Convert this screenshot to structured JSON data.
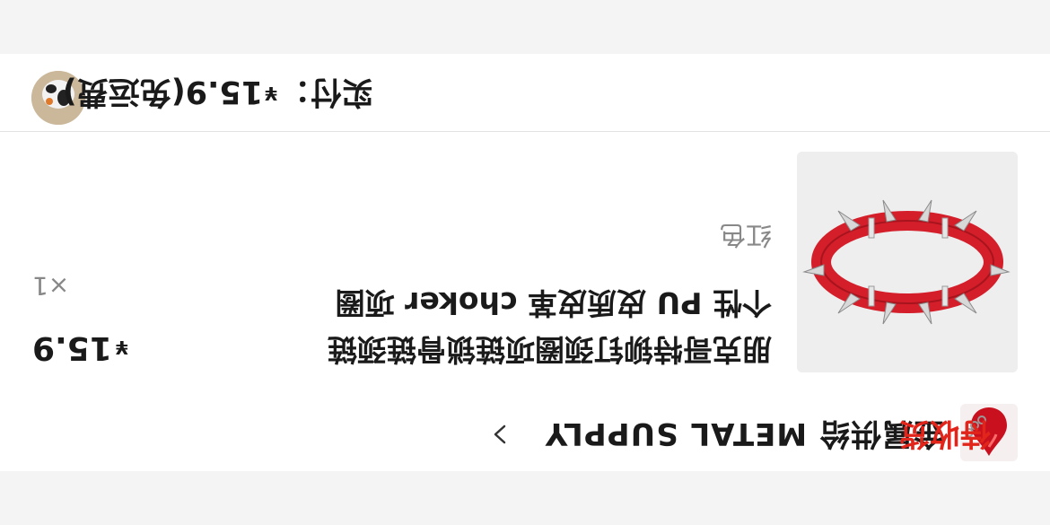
{
  "order": {
    "shop_name": "金属供给 METAL SUPPLY",
    "status": "待收货",
    "product_title": "朋克哥特铆钉颈圈项链锁骨链颈链个性 PU 皮质皮革 choker 项圈",
    "currency_symbol": "¥",
    "price": "15.9",
    "quantity": "×1",
    "variant": "红色"
  },
  "payment": {
    "label": "实付：",
    "currency_symbol": "¥",
    "amount": "15.9",
    "note": "(免运费)"
  },
  "colors": {
    "status": "#e1251b",
    "text": "#1a1a1a",
    "muted": "#888888",
    "choker": "#d41f2b"
  },
  "icons": [
    "chevron-right-icon"
  ]
}
